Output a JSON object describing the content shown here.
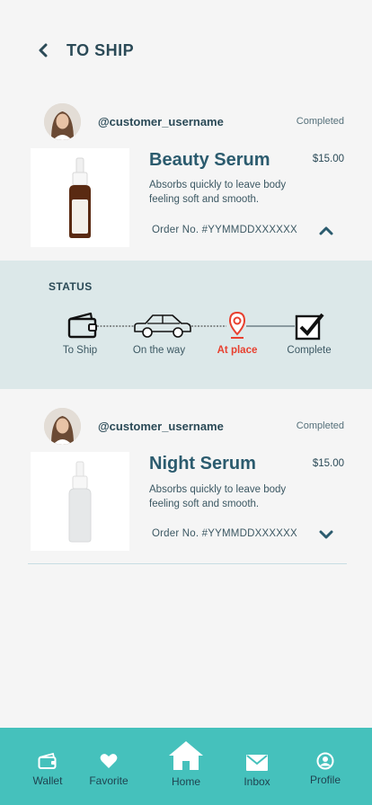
{
  "header": {
    "title": "TO SHIP"
  },
  "orders": [
    {
      "username": "@customer_username",
      "status": "Completed",
      "product_name": "Beauty Serum",
      "price": "$15.00",
      "description": "Absorbs quickly to leave body feeling soft and smooth.",
      "order_no": "Order No. #YYMMDDXXXXXX",
      "expanded": true
    },
    {
      "username": "@customer_username",
      "status": "Completed",
      "product_name": "Night Serum",
      "price": "$15.00",
      "description": "Absorbs quickly to leave body feeling soft and smooth.",
      "order_no": "Order No. #YYMMDDXXXXXX",
      "expanded": false
    }
  ],
  "tracking": {
    "heading": "STATUS",
    "steps": [
      {
        "label": "To Ship",
        "icon": "wallet-icon",
        "active": false
      },
      {
        "label": "On the way",
        "icon": "car-icon",
        "active": false
      },
      {
        "label": "At place",
        "icon": "location-pin-icon",
        "active": true
      },
      {
        "label": "Complete",
        "icon": "checkbox-icon",
        "active": false
      }
    ]
  },
  "bottom_nav": {
    "items": [
      {
        "label": "Wallet",
        "icon": "wallet-icon"
      },
      {
        "label": "Favorite",
        "icon": "heart-icon"
      },
      {
        "label": "Home",
        "icon": "home-icon"
      },
      {
        "label": "Inbox",
        "icon": "mail-icon"
      },
      {
        "label": "Profile",
        "icon": "profile-icon"
      }
    ]
  },
  "colors": {
    "background": "#f5f5f5",
    "accent": "#45c1bc",
    "status_panel": "#dce8e9",
    "active_step": "#e8402f",
    "title_text": "#2b4a57"
  }
}
